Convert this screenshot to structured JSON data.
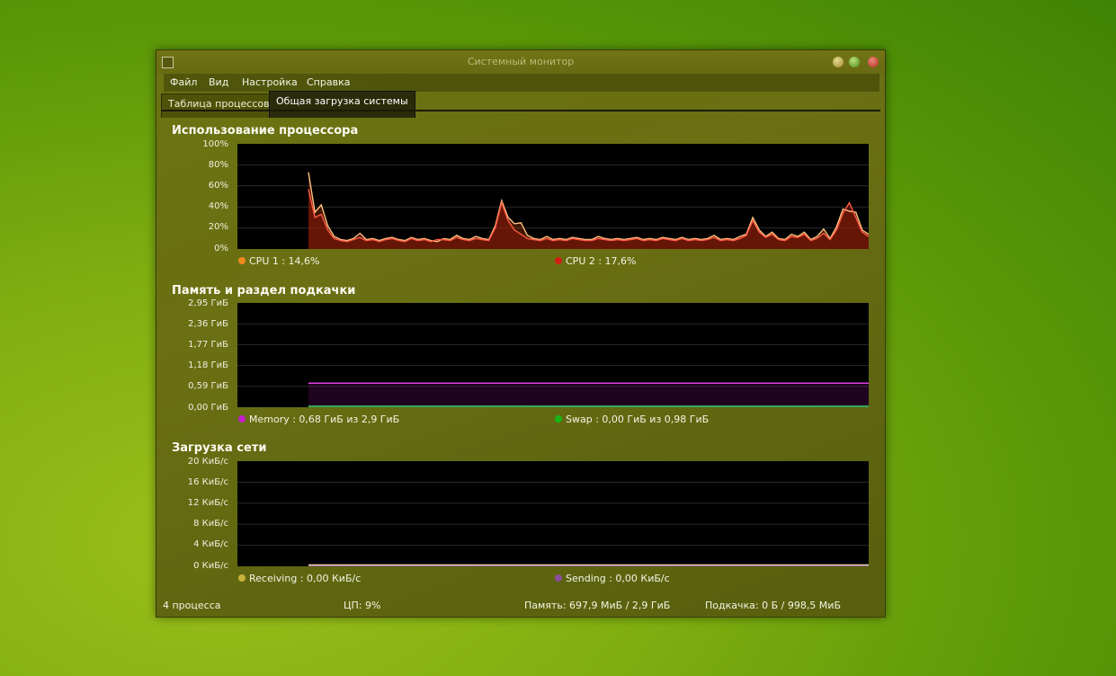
{
  "window": {
    "title": "Системный монитор",
    "buttons": [
      "minimize",
      "maximize",
      "close"
    ]
  },
  "menu": [
    "Файл",
    "Вид",
    "Настройка",
    "Справка"
  ],
  "tabs": [
    {
      "label": "Таблица процессов",
      "active": false
    },
    {
      "label": "Общая загрузка системы",
      "active": true
    }
  ],
  "cpu": {
    "title": "Использование процессора",
    "y_ticks": [
      "100%",
      "80%",
      "60%",
      "40%",
      "20%",
      "0%"
    ],
    "legend": [
      {
        "label": "CPU 1 : 14,6%",
        "color": "#f08a1e"
      },
      {
        "label": "CPU 2 : 17,6%",
        "color": "#d21e14"
      }
    ]
  },
  "memory": {
    "title": "Память и раздел подкачки",
    "y_ticks": [
      "2,95 ГиБ",
      "2,36 ГиБ",
      "1,77 ГиБ",
      "1,18 ГиБ",
      "0,59 ГиБ",
      "0,00 ГиБ"
    ],
    "legend": [
      {
        "label": "Memory : 0,68 ГиБ из 2,9 ГиБ",
        "color": "#c020c8"
      },
      {
        "label": "Swap : 0,00 ГиБ из 0,98 ГиБ",
        "color": "#18b418"
      }
    ]
  },
  "network": {
    "title": "Загрузка сети",
    "y_ticks": [
      "20 КиБ/с",
      "16 КиБ/с",
      "12 КиБ/с",
      "8 КиБ/с",
      "4 КиБ/с",
      "0 КиБ/с"
    ],
    "legend": [
      {
        "label": "Receiving : 0,00 КиБ/с",
        "color": "#c8b43c"
      },
      {
        "label": "Sending : 0,00 КиБ/с",
        "color": "#8a4ea0"
      }
    ]
  },
  "status": {
    "processes": "4 процесса",
    "cpu": "ЦП: 9%",
    "memory": "Память: 697,9 МиБ / 2,9 ГиБ",
    "swap": "Подкачка: 0 Б / 998,5 МиБ"
  },
  "chart_data": [
    {
      "type": "line",
      "title": "Использование процессора",
      "ylim": [
        0,
        100
      ],
      "y_unit": "%",
      "grid": true,
      "legend_position": "bottom",
      "series": [
        {
          "name": "CPU 1 : 14,6%",
          "values": [
            73,
            35,
            42,
            22,
            12,
            9,
            8,
            10,
            15,
            9,
            10,
            8,
            10,
            11,
            9,
            8,
            11,
            9,
            10,
            8,
            7,
            10,
            9,
            13,
            10,
            9,
            12,
            10,
            9,
            22,
            46,
            30,
            24,
            25,
            13,
            10,
            9,
            12,
            9,
            10,
            9,
            11,
            10,
            9,
            9,
            12,
            10,
            9,
            10,
            9,
            10,
            11,
            9,
            10,
            9,
            11,
            10,
            9,
            11,
            9,
            10,
            9,
            10,
            13,
            9,
            10,
            9,
            12,
            14,
            30,
            18,
            12,
            16,
            10,
            9,
            14,
            12,
            16,
            9,
            12,
            19,
            10,
            21,
            38,
            36,
            35,
            18,
            14
          ]
        },
        {
          "name": "CPU 2 : 17,6%",
          "values": [
            57,
            30,
            33,
            18,
            10,
            8,
            7,
            9,
            11,
            8,
            9,
            7,
            9,
            10,
            8,
            7,
            10,
            8,
            9,
            7,
            9,
            9,
            8,
            11,
            9,
            8,
            10,
            9,
            8,
            20,
            44,
            27,
            18,
            14,
            10,
            9,
            8,
            10,
            8,
            9,
            8,
            10,
            9,
            8,
            8,
            10,
            9,
            8,
            9,
            8,
            9,
            10,
            8,
            9,
            8,
            10,
            9,
            8,
            10,
            8,
            9,
            8,
            9,
            11,
            8,
            9,
            8,
            10,
            13,
            27,
            16,
            11,
            14,
            9,
            8,
            12,
            11,
            14,
            8,
            10,
            15,
            9,
            18,
            34,
            44,
            30,
            16,
            12
          ]
        }
      ]
    },
    {
      "type": "line",
      "title": "Память и раздел подкачки",
      "ylim": [
        0,
        2.95
      ],
      "y_unit": "ГиБ",
      "grid": true,
      "legend_position": "bottom",
      "series": [
        {
          "name": "Memory : 0,68 ГиБ из 2,9 ГиБ",
          "values": [
            0.68,
            0.68
          ]
        },
        {
          "name": "Swap : 0,00 ГиБ из 0,98 ГиБ",
          "values": [
            0.0,
            0.0
          ]
        }
      ]
    },
    {
      "type": "line",
      "title": "Загрузка сети",
      "ylim": [
        0,
        20
      ],
      "y_unit": "КиБ/с",
      "grid": true,
      "legend_position": "bottom",
      "series": [
        {
          "name": "Receiving : 0,00 КиБ/с",
          "values": [
            0.0,
            0.0
          ]
        },
        {
          "name": "Sending : 0,00 КиБ/с",
          "values": [
            0.0,
            0.0
          ]
        }
      ]
    }
  ]
}
